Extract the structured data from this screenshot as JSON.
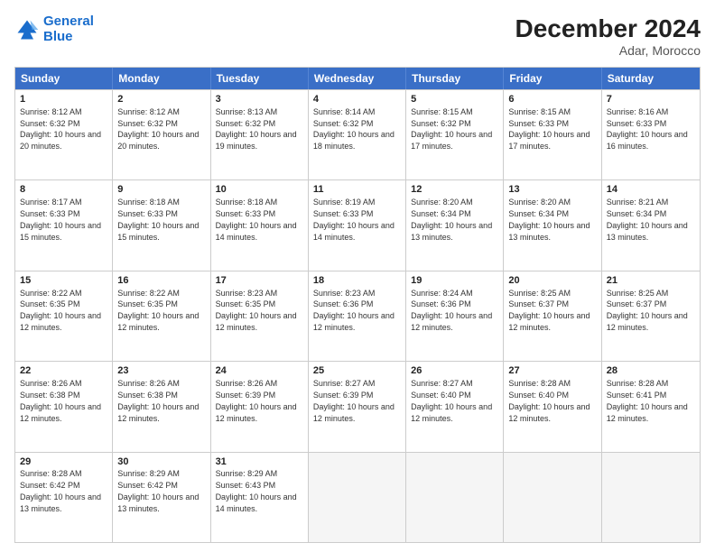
{
  "logo": {
    "line1": "General",
    "line2": "Blue"
  },
  "title": "December 2024",
  "subtitle": "Adar, Morocco",
  "days": [
    "Sunday",
    "Monday",
    "Tuesday",
    "Wednesday",
    "Thursday",
    "Friday",
    "Saturday"
  ],
  "weeks": [
    [
      {
        "day": "1",
        "sunrise": "8:12 AM",
        "sunset": "6:32 PM",
        "daylight": "10 hours and 20 minutes."
      },
      {
        "day": "2",
        "sunrise": "8:12 AM",
        "sunset": "6:32 PM",
        "daylight": "10 hours and 20 minutes."
      },
      {
        "day": "3",
        "sunrise": "8:13 AM",
        "sunset": "6:32 PM",
        "daylight": "10 hours and 19 minutes."
      },
      {
        "day": "4",
        "sunrise": "8:14 AM",
        "sunset": "6:32 PM",
        "daylight": "10 hours and 18 minutes."
      },
      {
        "day": "5",
        "sunrise": "8:15 AM",
        "sunset": "6:32 PM",
        "daylight": "10 hours and 17 minutes."
      },
      {
        "day": "6",
        "sunrise": "8:15 AM",
        "sunset": "6:33 PM",
        "daylight": "10 hours and 17 minutes."
      },
      {
        "day": "7",
        "sunrise": "8:16 AM",
        "sunset": "6:33 PM",
        "daylight": "10 hours and 16 minutes."
      }
    ],
    [
      {
        "day": "8",
        "sunrise": "8:17 AM",
        "sunset": "6:33 PM",
        "daylight": "10 hours and 15 minutes."
      },
      {
        "day": "9",
        "sunrise": "8:18 AM",
        "sunset": "6:33 PM",
        "daylight": "10 hours and 15 minutes."
      },
      {
        "day": "10",
        "sunrise": "8:18 AM",
        "sunset": "6:33 PM",
        "daylight": "10 hours and 14 minutes."
      },
      {
        "day": "11",
        "sunrise": "8:19 AM",
        "sunset": "6:33 PM",
        "daylight": "10 hours and 14 minutes."
      },
      {
        "day": "12",
        "sunrise": "8:20 AM",
        "sunset": "6:34 PM",
        "daylight": "10 hours and 13 minutes."
      },
      {
        "day": "13",
        "sunrise": "8:20 AM",
        "sunset": "6:34 PM",
        "daylight": "10 hours and 13 minutes."
      },
      {
        "day": "14",
        "sunrise": "8:21 AM",
        "sunset": "6:34 PM",
        "daylight": "10 hours and 13 minutes."
      }
    ],
    [
      {
        "day": "15",
        "sunrise": "8:22 AM",
        "sunset": "6:35 PM",
        "daylight": "10 hours and 12 minutes."
      },
      {
        "day": "16",
        "sunrise": "8:22 AM",
        "sunset": "6:35 PM",
        "daylight": "10 hours and 12 minutes."
      },
      {
        "day": "17",
        "sunrise": "8:23 AM",
        "sunset": "6:35 PM",
        "daylight": "10 hours and 12 minutes."
      },
      {
        "day": "18",
        "sunrise": "8:23 AM",
        "sunset": "6:36 PM",
        "daylight": "10 hours and 12 minutes."
      },
      {
        "day": "19",
        "sunrise": "8:24 AM",
        "sunset": "6:36 PM",
        "daylight": "10 hours and 12 minutes."
      },
      {
        "day": "20",
        "sunrise": "8:25 AM",
        "sunset": "6:37 PM",
        "daylight": "10 hours and 12 minutes."
      },
      {
        "day": "21",
        "sunrise": "8:25 AM",
        "sunset": "6:37 PM",
        "daylight": "10 hours and 12 minutes."
      }
    ],
    [
      {
        "day": "22",
        "sunrise": "8:26 AM",
        "sunset": "6:38 PM",
        "daylight": "10 hours and 12 minutes."
      },
      {
        "day": "23",
        "sunrise": "8:26 AM",
        "sunset": "6:38 PM",
        "daylight": "10 hours and 12 minutes."
      },
      {
        "day": "24",
        "sunrise": "8:26 AM",
        "sunset": "6:39 PM",
        "daylight": "10 hours and 12 minutes."
      },
      {
        "day": "25",
        "sunrise": "8:27 AM",
        "sunset": "6:39 PM",
        "daylight": "10 hours and 12 minutes."
      },
      {
        "day": "26",
        "sunrise": "8:27 AM",
        "sunset": "6:40 PM",
        "daylight": "10 hours and 12 minutes."
      },
      {
        "day": "27",
        "sunrise": "8:28 AM",
        "sunset": "6:40 PM",
        "daylight": "10 hours and 12 minutes."
      },
      {
        "day": "28",
        "sunrise": "8:28 AM",
        "sunset": "6:41 PM",
        "daylight": "10 hours and 12 minutes."
      }
    ],
    [
      {
        "day": "29",
        "sunrise": "8:28 AM",
        "sunset": "6:42 PM",
        "daylight": "10 hours and 13 minutes."
      },
      {
        "day": "30",
        "sunrise": "8:29 AM",
        "sunset": "6:42 PM",
        "daylight": "10 hours and 13 minutes."
      },
      {
        "day": "31",
        "sunrise": "8:29 AM",
        "sunset": "6:43 PM",
        "daylight": "10 hours and 14 minutes."
      },
      null,
      null,
      null,
      null
    ]
  ]
}
